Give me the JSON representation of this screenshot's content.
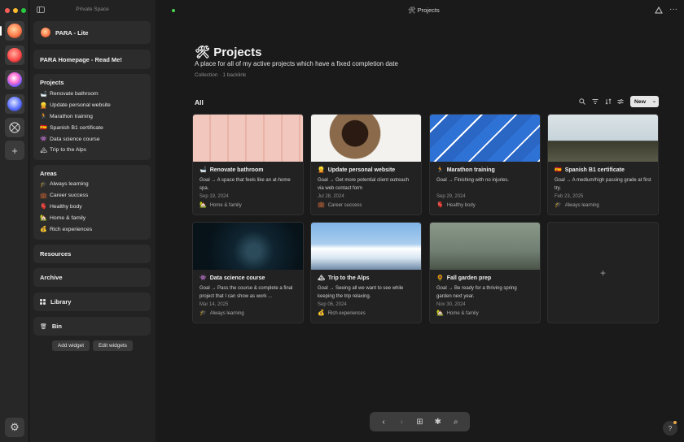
{
  "window": {
    "space_name": "Private Space",
    "breadcrumb_icon": "🛠",
    "breadcrumb": "Projects",
    "share_icon": "share-icon",
    "more_icon": "more-icon"
  },
  "rail": {
    "spaces": [
      {
        "name": "space-1",
        "color": "#ff8a5a"
      },
      {
        "name": "space-2",
        "color": "#ff5e5e"
      },
      {
        "name": "space-3",
        "color": "#ff60c8"
      },
      {
        "name": "space-4",
        "color": "#6a7dff"
      }
    ],
    "add_label": "+",
    "settings_label": "⚙"
  },
  "sidebar": {
    "space_widget": {
      "label": "PARA - Lite"
    },
    "homepage": {
      "label": "PARA Homepage - Read Me!"
    },
    "projects": {
      "title": "Projects",
      "items": [
        {
          "emoji": "🛁",
          "label": "Renovate bathroom"
        },
        {
          "emoji": "👱",
          "label": "Update personal website"
        },
        {
          "emoji": "🏃",
          "label": "Marathon training"
        },
        {
          "emoji": "🇪🇸",
          "label": "Spanish B1 certificate"
        },
        {
          "emoji": "👾",
          "label": "Data science course"
        },
        {
          "emoji": "🏔",
          "label": "Trip to the Alps"
        }
      ]
    },
    "areas": {
      "title": "Areas",
      "items": [
        {
          "emoji": "🎓",
          "label": "Always learning"
        },
        {
          "emoji": "💼",
          "label": "Career success"
        },
        {
          "emoji": "🫀",
          "label": "Healthy body"
        },
        {
          "emoji": "🏡",
          "label": "Home & family"
        },
        {
          "emoji": "💰",
          "label": "Rich experiences"
        }
      ]
    },
    "resources": "Resources",
    "archive": "Archive",
    "library": {
      "icon": "▪",
      "label": "Library"
    },
    "bin": {
      "icon": "🗑",
      "label": "Bin"
    },
    "add_widget": "Add widget",
    "edit_widgets": "Edit widgets"
  },
  "page": {
    "title_icon": "🛠",
    "title": "Projects",
    "description": "A place for all of my active projects which have a fixed completion date",
    "meta_type": "Collection",
    "meta_separator": "·",
    "meta_backlinks": "1 backlink",
    "view_tab": "All",
    "new_button": "New",
    "new_chevron": "⌄"
  },
  "cards": [
    {
      "emoji": "🛁",
      "title": "Renovate bathroom",
      "desc": "Goal → A space that feels like an at-home spa.",
      "date": "Sep 19, 2024",
      "area_emoji": "🏡",
      "area": "Home & family"
    },
    {
      "emoji": "👱",
      "title": "Update personal website",
      "desc": "Goal → Get more potential client outreach via web contact form",
      "date": "Jul 28, 2024",
      "area_emoji": "💼",
      "area": "Career success"
    },
    {
      "emoji": "🏃",
      "title": "Marathon training",
      "desc": "Goal → Finishing with no injuries.",
      "date": "Sep 29, 2024",
      "area_emoji": "🫀",
      "area": "Healthy body"
    },
    {
      "emoji": "🇪🇸",
      "title": "Spanish B1 certificate",
      "desc": "Goal → A medium/high passing grade at first try.",
      "date": "Feb 23, 2025",
      "area_emoji": "🎓",
      "area": "Always learning"
    },
    {
      "emoji": "👾",
      "title": "Data science course",
      "desc": "Goal → Pass the course & complete a final project that I can show as work ...",
      "date": "Mar 14, 2025",
      "area_emoji": "🎓",
      "area": "Always learning"
    },
    {
      "emoji": "🏔",
      "title": "Trip to the Alps",
      "desc": "Goal → Seeing all we want to see while keeping the trip relaxing.",
      "date": "Sep 06, 2024",
      "area_emoji": "💰",
      "area": "Rich experiences"
    },
    {
      "emoji": "🌻",
      "title": "Fall garden prep",
      "desc": "Goal → Be ready for a thriving spring garden next year.",
      "date": "Nov 30, 2024",
      "area_emoji": "🏡",
      "area": "Home & family"
    }
  ],
  "add_card_label": "+",
  "bottom_bar": {
    "back": "‹",
    "forward": "›",
    "new": "⊞",
    "graph": "✱",
    "search": "⌕"
  },
  "help_label": "?"
}
